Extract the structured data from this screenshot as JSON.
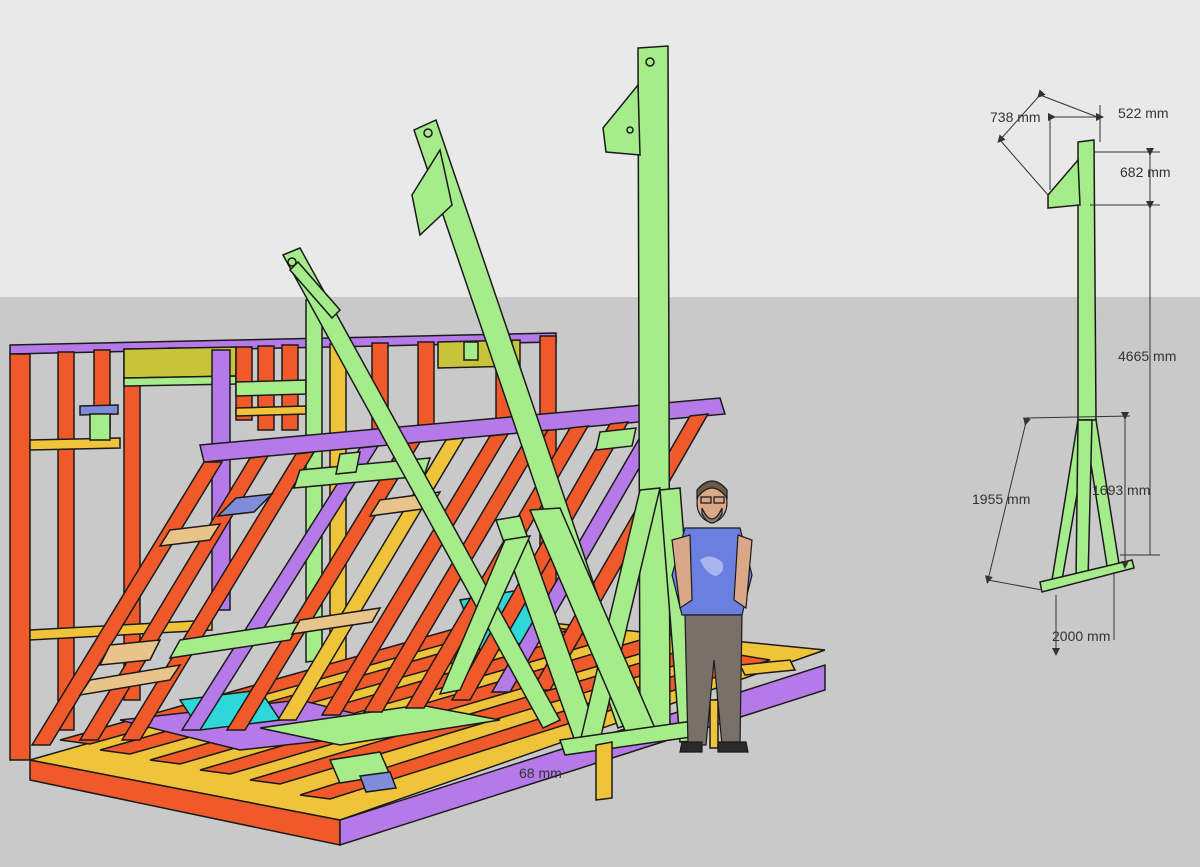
{
  "colors": {
    "sky": "#e9e9e9",
    "ground": "#c9c9c9",
    "orange": "#f05a2a",
    "purple": "#b57ae8",
    "green": "#a6ec8a",
    "yellow": "#f0c43a",
    "cyan": "#2fd8d8",
    "olive": "#c8c43a",
    "tan": "#e8c48a",
    "blue": "#7f8cd8",
    "outline": "#1a1a1a"
  },
  "dimensions": {
    "d738": "738 mm",
    "d522": "522 mm",
    "d682": "682 mm",
    "d4665": "4665 mm",
    "d1955": "1955 mm",
    "d1693": "1693 mm",
    "d2000": "2000 mm",
    "d68": "68 mm"
  }
}
